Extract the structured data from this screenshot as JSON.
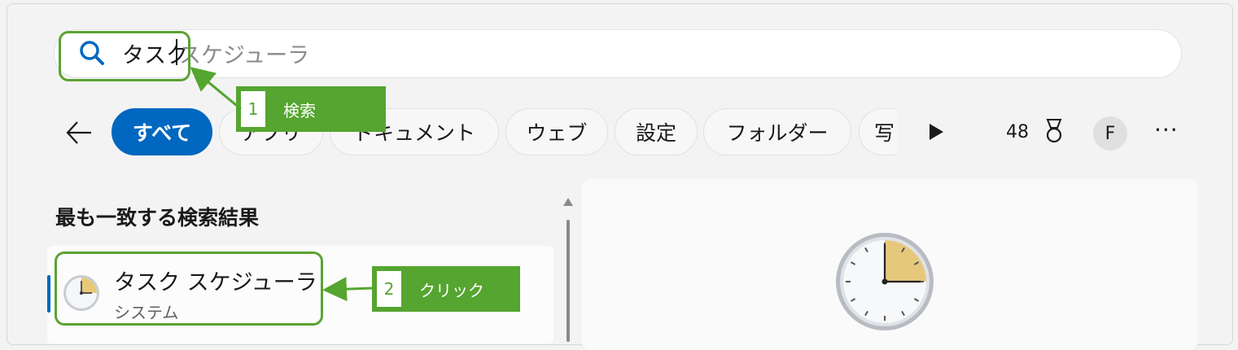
{
  "search": {
    "typed": "タスク",
    "suggestion": "スケジューラ"
  },
  "filters": {
    "chips": [
      "すべて",
      "アプリ",
      "ドキュメント",
      "ウェブ",
      "設定",
      "フォルダー",
      "写"
    ]
  },
  "header_right": {
    "points": "48",
    "avatar": "F",
    "more": "···"
  },
  "results": {
    "section_title": "最も一致する検索結果",
    "best_match": {
      "name": "タスク スケジューラ",
      "subtitle": "システム"
    }
  },
  "annotations": {
    "step1_number": "1",
    "step1_label": "検索",
    "step2_number": "2",
    "step2_label": "クリック"
  },
  "colors": {
    "accent": "#0067c0",
    "annotation_green": "#55a530"
  },
  "icons": [
    "search-icon",
    "back-arrow-icon",
    "play-icon",
    "medal-icon",
    "more-icon",
    "clock-icon"
  ]
}
